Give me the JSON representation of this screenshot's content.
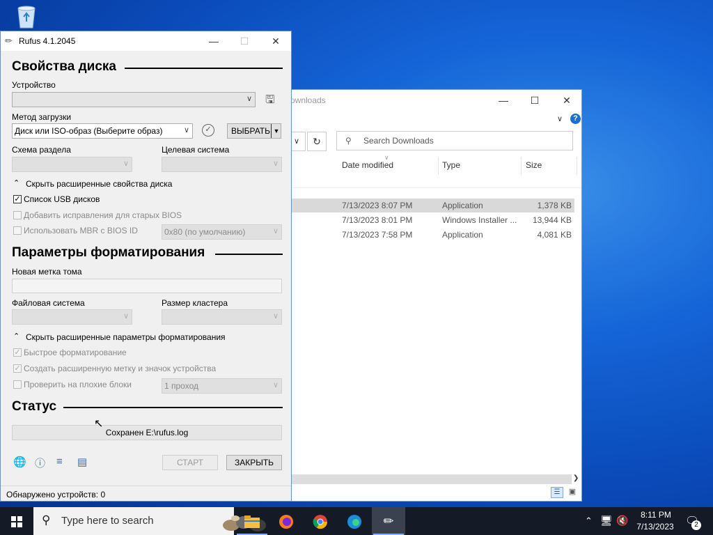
{
  "explorer": {
    "title_fragment": "ownloads",
    "search_placeholder": "Search Downloads",
    "columns": [
      "Date modified",
      "Type",
      "Size"
    ],
    "rows": [
      {
        "date": "7/13/2023 8:07 PM",
        "type": "Application",
        "size": "1,378 KB"
      },
      {
        "date": "7/13/2023 8:01 PM",
        "type": "Windows Installer ...",
        "size": "13,944 KB"
      },
      {
        "date": "7/13/2023 7:58 PM",
        "type": "Application",
        "size": "4,081 KB"
      }
    ]
  },
  "rufus": {
    "title": "Rufus 4.1.2045",
    "drive_section": "Свойства диска",
    "device_label": "Устройство",
    "device_value": "",
    "boot_label": "Метод загрузки",
    "boot_value": "Диск или ISO-образ (Выберите образ)",
    "select_button": "ВЫБРАТЬ",
    "partition_label": "Схема раздела",
    "target_label": "Целевая система",
    "hide_drive_adv": "Скрыть расширенные свойства диска",
    "list_usb": "Список USB дисков",
    "old_bios": "Добавить исправления для старых BIOS",
    "use_mbr": "Использовать MBR с BIOS ID",
    "mbr_value": "0x80 (по умолчанию)",
    "format_section": "Параметры форматирования",
    "volume_label": "Новая метка тома",
    "fs_label": "Файловая система",
    "cluster_label": "Размер кластера",
    "hide_format_adv": "Скрыть расширенные параметры форматирования",
    "quick_format": "Быстрое форматирование",
    "extended_label": "Создать расширенную метку и значок устройства",
    "bad_blocks": "Проверить на плохие блоки",
    "passes_value": "1 проход",
    "status_section": "Статус",
    "status_text": "Сохранен E:\\rufus.log",
    "start_button": "СТАРТ",
    "close_button": "ЗАКРЫТЬ",
    "footer": "Обнаружено устройств: 0"
  },
  "taskbar": {
    "search_placeholder": "Type here to search",
    "time": "8:11 PM",
    "date": "7/13/2023",
    "notifications": "2"
  }
}
